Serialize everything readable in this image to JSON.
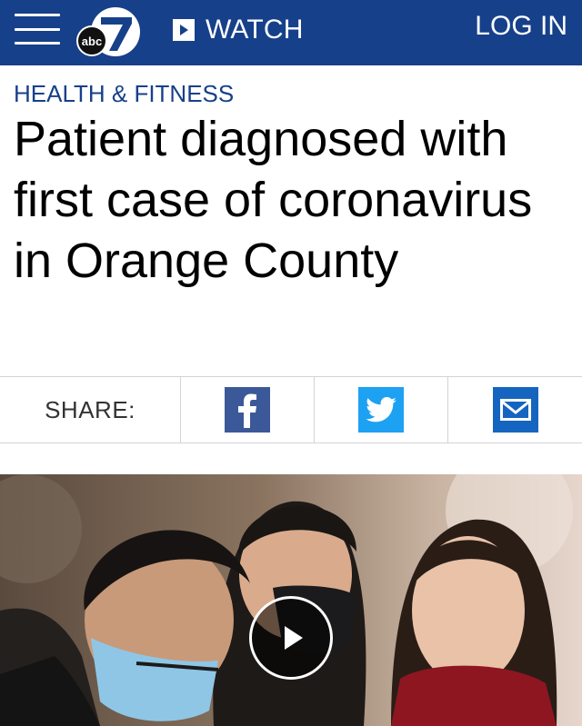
{
  "header": {
    "brand_small": "abc",
    "brand_number": "7",
    "watch_label": "WATCH",
    "login_label": "LOG IN",
    "colors": {
      "bar": "#17408a",
      "text": "#ffffff"
    }
  },
  "article": {
    "section": "HEALTH & FITNESS",
    "headline": "Patient diagnosed with first case of coronavirus in Orange County"
  },
  "share": {
    "label": "SHARE:",
    "buttons": [
      {
        "name": "facebook",
        "icon": "facebook-icon",
        "color": "#3b5998"
      },
      {
        "name": "twitter",
        "icon": "twitter-icon",
        "color": "#1da1f2"
      },
      {
        "name": "email",
        "icon": "mail-icon",
        "color": "#1565c0"
      }
    ]
  },
  "media": {
    "type": "video",
    "icon": "play-icon"
  }
}
